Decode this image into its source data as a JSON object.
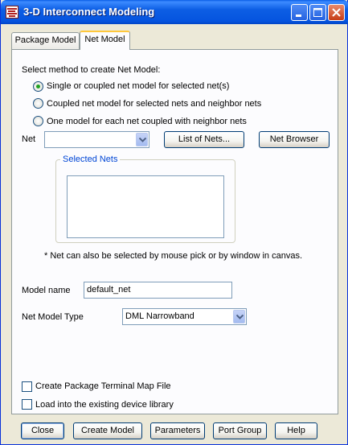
{
  "window": {
    "title": "3-D Interconnect Modeling"
  },
  "tabs": [
    {
      "label": "Package Model",
      "active": false
    },
    {
      "label": "Net Model",
      "active": true
    }
  ],
  "method": {
    "prompt": "Select method to create Net Model:",
    "options": [
      {
        "label": "Single or coupled net model for selected net(s)",
        "selected": true
      },
      {
        "label": "Coupled net model for selected nets and neighbor nets",
        "selected": false
      },
      {
        "label": "One model for each net coupled with neighbor nets",
        "selected": false
      }
    ]
  },
  "net": {
    "label": "Net",
    "value": "",
    "list_button": "List of Nets...",
    "browser_button": "Net Browser"
  },
  "selected_nets": {
    "title": "Selected Nets",
    "items": []
  },
  "note": "* Net can also be selected by mouse pick or by window in canvas.",
  "model_name": {
    "label": "Model name",
    "value": "default_net"
  },
  "net_model_type": {
    "label": "Net Model Type",
    "value": "DML Narrowband"
  },
  "options": [
    {
      "label": "Create Package Terminal Map File",
      "checked": false
    },
    {
      "label": "Load into the existing device library",
      "checked": false
    }
  ],
  "buttons": {
    "close": "Close",
    "create_model": "Create Model",
    "parameters": "Parameters",
    "port_group": "Port Group",
    "help": "Help"
  },
  "colors": {
    "titlebar": "#0554df",
    "tab_highlight": "#ffc83c",
    "group_title": "#0046d5",
    "radio_dot": "#21a121"
  }
}
